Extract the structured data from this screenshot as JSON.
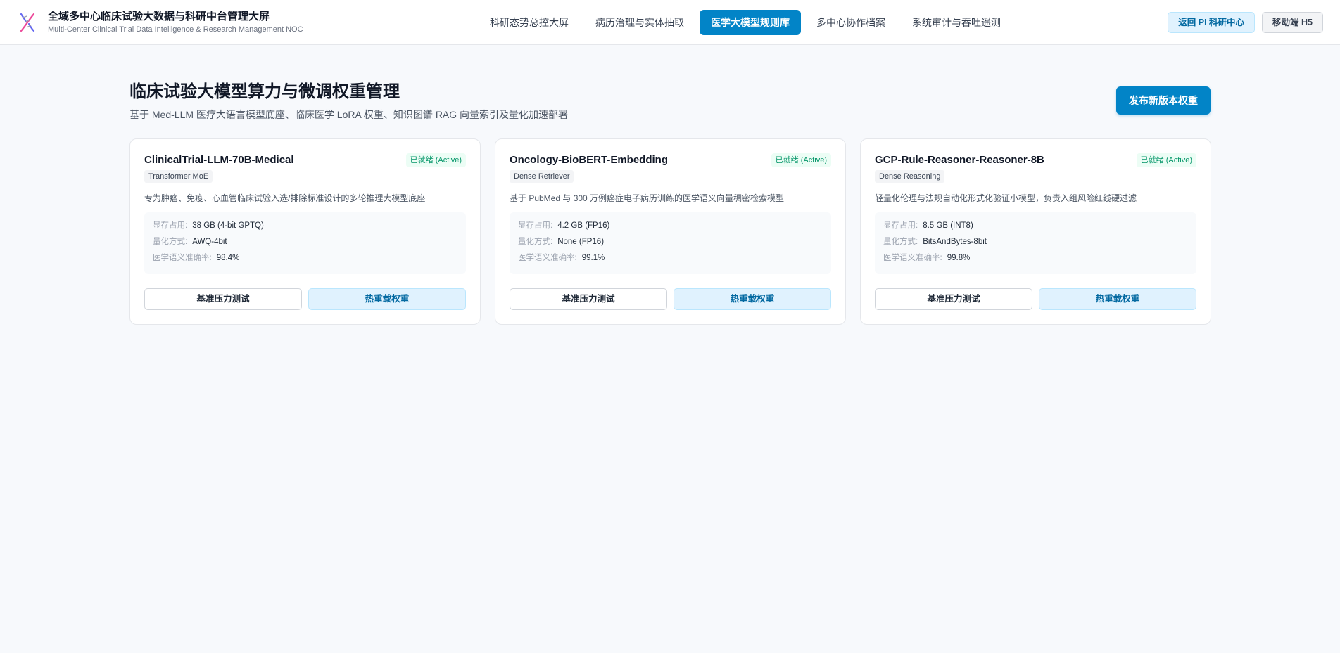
{
  "header": {
    "title": "全域多中心临床试验大数据与科研中台管理大屏",
    "subtitle": "Multi-Center Clinical Trial Data Intelligence & Research Management NOC",
    "logo_icon": "dna-icon",
    "nav": [
      {
        "label": "科研态势总控大屏",
        "active": false
      },
      {
        "label": "病历治理与实体抽取",
        "active": false
      },
      {
        "label": "医学大模型规则库",
        "active": true
      },
      {
        "label": "多中心协作档案",
        "active": false
      },
      {
        "label": "系统审计与吞吐遥测",
        "active": false
      }
    ],
    "back_button": "返回 PI 科研中心",
    "mobile_button": "移动端 H5"
  },
  "page": {
    "title": "临床试验大模型算力与微调权重管理",
    "subtitle": "基于 Med-LLM 医疗大语言模型底座、临床医学 LoRA 权重、知识图谱 RAG 向量索引及量化加速部署",
    "publish_button": "发布新版本权重"
  },
  "cards": [
    {
      "name": "ClinicalTrial-LLM-70B-Medical",
      "status": "已就绪 (Active)",
      "tag": "Transformer MoE",
      "desc": "专为肿瘤、免疫、心血管临床试验入选/排除标准设计的多轮推理大模型底座",
      "specs": [
        {
          "label": "显存占用:",
          "value": "38 GB (4-bit GPTQ)"
        },
        {
          "label": "量化方式:",
          "value": "AWQ-4bit"
        },
        {
          "label": "医学语义准确率:",
          "value": "98.4%"
        }
      ],
      "bench_button": "基准压力测试",
      "reload_button": "热重载权重"
    },
    {
      "name": "Oncology-BioBERT-Embedding",
      "status": "已就绪 (Active)",
      "tag": "Dense Retriever",
      "desc": "基于 PubMed 与 300 万例癌症电子病历训练的医学语义向量稠密检索模型",
      "specs": [
        {
          "label": "显存占用:",
          "value": "4.2 GB (FP16)"
        },
        {
          "label": "量化方式:",
          "value": "None (FP16)"
        },
        {
          "label": "医学语义准确率:",
          "value": "99.1%"
        }
      ],
      "bench_button": "基准压力测试",
      "reload_button": "热重载权重"
    },
    {
      "name": "GCP-Rule-Reasoner-Reasoner-8B",
      "status": "已就绪 (Active)",
      "tag": "Dense Reasoning",
      "desc": "轻量化伦理与法规自动化形式化验证小模型，负责入组风险红线硬过滤",
      "specs": [
        {
          "label": "显存占用:",
          "value": "8.5 GB (INT8)"
        },
        {
          "label": "量化方式:",
          "value": "BitsAndBytes-8bit"
        },
        {
          "label": "医学语义准确率:",
          "value": "99.8%"
        }
      ],
      "bench_button": "基准压力测试",
      "reload_button": "热重载权重"
    }
  ],
  "colors": {
    "accent": "#0284c7",
    "status_green": "#059669",
    "background": "#f7f9fc"
  }
}
